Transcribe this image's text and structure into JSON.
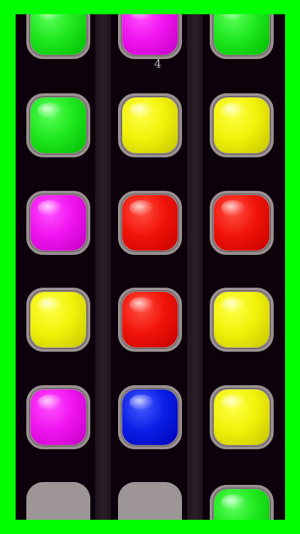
{
  "score": "4",
  "colors": {
    "frame": "#00ff00",
    "board": "#0d020c",
    "green": "#1fe81f",
    "magenta": "#f014f0",
    "yellow": "#f2f20a",
    "red": "#f21408",
    "blue": "#0a1fe6",
    "empty": "#9e9597"
  },
  "grid": [
    [
      "green",
      "magenta",
      "green"
    ],
    [
      "green",
      "yellow",
      "yellow"
    ],
    [
      "magenta",
      "red",
      "red"
    ],
    [
      "yellow",
      "red",
      "yellow"
    ],
    [
      "magenta",
      "blue",
      "yellow"
    ],
    [
      "empty",
      "empty",
      "green"
    ]
  ]
}
